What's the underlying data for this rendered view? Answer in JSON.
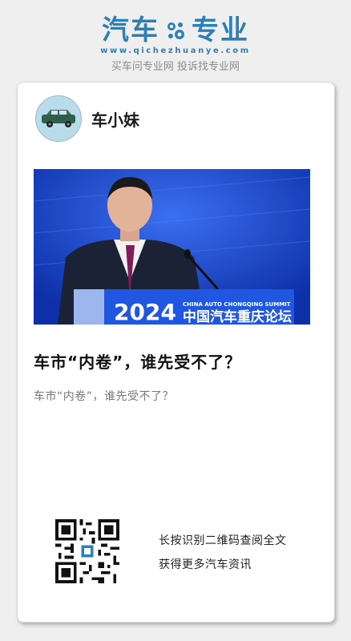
{
  "brand": {
    "name_left": "汽车",
    "name_right": "专业",
    "url": "www.qichezhuanye.com",
    "slogan": "买车问专业网 投诉找专业网",
    "color": "#2e7fb3"
  },
  "author": {
    "name": "车小妹",
    "avatar_icon": "car-avatar-icon"
  },
  "article": {
    "title": "车市“内卷”，谁先受不了？",
    "summary": "车市“内卷”，谁先受不了？",
    "image_alt": "speaker-at-podium-photo",
    "banner_year": "2024",
    "banner_en": "CHINA AUTO CHONGQING SUMMIT",
    "banner_cn": "中国汽车重庆论坛"
  },
  "qr": {
    "icon": "qr-code-icon",
    "line1": "长按识别二维码查阅全文",
    "line2": "获得更多汽车资讯"
  }
}
